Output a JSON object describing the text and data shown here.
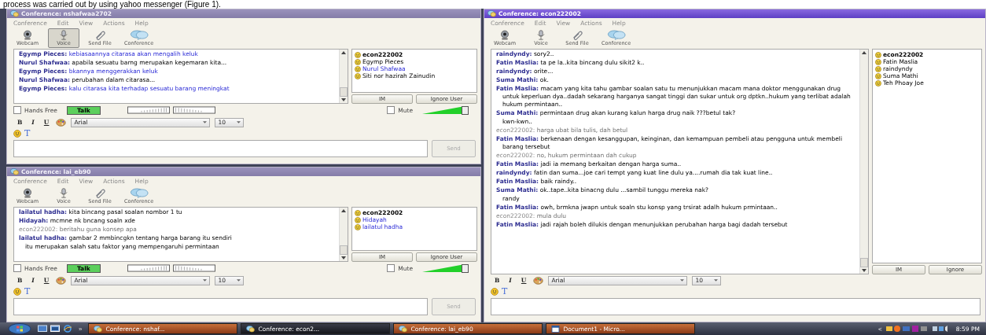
{
  "document_text": "process was carried out by using yahoo messenger (Figure 1).",
  "windows": [
    {
      "title": "Conference: nshafwaa2702",
      "active": false,
      "menu": [
        "Conference",
        "Edit",
        "View",
        "Actions",
        "Help"
      ],
      "toolbar": [
        {
          "kind": "webcam",
          "label": "Webcam",
          "selected": false
        },
        {
          "kind": "voice",
          "label": "Voice",
          "selected": true
        },
        {
          "kind": "file",
          "label": "Send File",
          "selected": false
        },
        {
          "kind": "conference",
          "label": "Conference",
          "selected": false
        }
      ],
      "messages": [
        {
          "kind": "message",
          "sender": "Egymp Pieces:",
          "text": "kebiasaannya citarasa akan mengalih keluk",
          "highlight": true
        },
        {
          "kind": "message",
          "sender": "Nurul Shafwaa:",
          "text": "apabila sesuatu barng merupakan kegemaran kita...",
          "highlight": false
        },
        {
          "kind": "message",
          "sender": "Egymp Pieces:",
          "text": "bkannya menggerakkan keluk",
          "highlight": true
        },
        {
          "kind": "message",
          "sender": "Nurul Shafwaa:",
          "text": "perubahan dalam citarasa...",
          "highlight": false
        },
        {
          "kind": "message",
          "sender": "Egymp Pieces:",
          "text": "kalu citarasa kita terhadap sesuatu barang meningkat",
          "highlight": true
        }
      ],
      "participants": [
        {
          "name": "econ222002",
          "bold": true,
          "highlight": false
        },
        {
          "name": "Egymp Pieces",
          "bold": false,
          "highlight": false
        },
        {
          "name": "Nurul Shafwaa",
          "bold": false,
          "highlight": true
        },
        {
          "name": "Siti nor hazirah Zainudin",
          "bold": false,
          "highlight": false
        }
      ],
      "im_label": "IM",
      "ignore_label": "Ignore User",
      "voice": {
        "hands_free": "Hands Free",
        "hands_free_checked": false,
        "talk": "Talk",
        "mute": "Mute",
        "mute_checked": false,
        "level": 0.9
      },
      "format": {
        "bold": "B",
        "italic": "I",
        "underline": "U",
        "font": "Arial",
        "size": "10",
        "style_glyph": "T"
      },
      "send_label": "Send"
    },
    {
      "title": "Conference: lai_eb90",
      "active": false,
      "menu": [
        "Conference",
        "Edit",
        "View",
        "Actions",
        "Help"
      ],
      "toolbar": [
        {
          "kind": "webcam",
          "label": "Webcam",
          "selected": false
        },
        {
          "kind": "voice",
          "label": "Voice",
          "selected": false
        },
        {
          "kind": "file",
          "label": "Send File",
          "selected": false
        },
        {
          "kind": "conference",
          "label": "Conference",
          "selected": false
        }
      ],
      "messages": [
        {
          "kind": "message",
          "sender": "lailatul hadha:",
          "text": "kita bincang pasal soalan nombor 1 tu",
          "highlight": false
        },
        {
          "kind": "message",
          "sender": "Hidayah:",
          "text": "mcmne nk bncang soaln xde",
          "highlight": false
        },
        {
          "kind": "self",
          "sender": "econ222002:",
          "text": "beritahu guna konsep apa",
          "highlight": false
        },
        {
          "kind": "message",
          "sender": "lailatul hadha:",
          "text": "gambar 2 mmbincgkn tentang harga barang itu sendiri",
          "highlight": false
        },
        {
          "kind": "continuation",
          "text": "itu merupakan salah satu faktor yang mempengaruhi permintaan",
          "highlight": false
        }
      ],
      "participants": [
        {
          "name": "econ222002",
          "bold": true,
          "highlight": false
        },
        {
          "name": "Hidayah",
          "bold": false,
          "highlight": true
        },
        {
          "name": "lailatul hadha",
          "bold": false,
          "highlight": true
        }
      ],
      "im_label": "IM",
      "ignore_label": "Ignore User",
      "voice": {
        "hands_free": "Hands Free",
        "hands_free_checked": false,
        "talk": "Talk",
        "mute": "Mute",
        "mute_checked": false,
        "level": 0.9
      },
      "format": {
        "bold": "B",
        "italic": "I",
        "underline": "U",
        "font": "Arial",
        "size": "10",
        "style_glyph": "T"
      },
      "send_label": "Send"
    },
    {
      "title": "Conference: econ222002",
      "active": true,
      "menu": [
        "Conference",
        "Edit",
        "View",
        "Actions",
        "Help"
      ],
      "toolbar": [
        {
          "kind": "webcam",
          "label": "Webcam",
          "selected": false
        },
        {
          "kind": "voice",
          "label": "Voice",
          "selected": false
        },
        {
          "kind": "file",
          "label": "Send File",
          "selected": false
        },
        {
          "kind": "conference",
          "label": "Conference",
          "selected": false
        }
      ],
      "messages": [
        {
          "kind": "message",
          "sender": "raindyndy:",
          "text": "sory2..",
          "highlight": false
        },
        {
          "kind": "message",
          "sender": "Fatin Maslia:",
          "text": "ta pe la..kita bincang dulu sikit2 k..",
          "highlight": false
        },
        {
          "kind": "message",
          "sender": "raindyndy:",
          "text": "orite...",
          "highlight": false
        },
        {
          "kind": "message",
          "sender": "Suma Mathi:",
          "text": "ok.",
          "highlight": false
        },
        {
          "kind": "message",
          "sender": "Fatin Maslia:",
          "text": "macam yang kita tahu gambar soalan satu tu menunjukkan macam mana doktor menggunakan drug untuk keperluan dya..dadah sekarang harganya sangat tinggi dan sukar untuk org dptkn..hukum yang terlibat adalah hukum permintaan..",
          "highlight": false
        },
        {
          "kind": "message",
          "sender": "Suma Mathi:",
          "text": "permintaan drug akan kurang kalun harga drug naik ???betul tak?",
          "highlight": false
        },
        {
          "kind": "continuation",
          "text": "kwn-kwn..",
          "highlight": false
        },
        {
          "kind": "self",
          "sender": "econ222002:",
          "text": "harga ubat bila tulis, dah betul",
          "highlight": false
        },
        {
          "kind": "message",
          "sender": "Fatin Maslia:",
          "text": "berkenaan dengan kesanggupan, keinginan, dan kemampuan pembeli atau pengguna untuk membeli barang tersebut",
          "highlight": false
        },
        {
          "kind": "self",
          "sender": "econ222002:",
          "text": "no, hukum permintaan dah cukup",
          "highlight": false
        },
        {
          "kind": "message",
          "sender": "Fatin Maslia:",
          "text": "jadi ia memang berkaitan dengan harga suma..",
          "highlight": false
        },
        {
          "kind": "message",
          "sender": "raindyndy:",
          "text": "fatin dan suma...joe cari tempt yang kuat line dulu ya....rumah dia tak kuat line..",
          "highlight": false
        },
        {
          "kind": "message",
          "sender": "Fatin Maslia:",
          "text": "baik raindy..",
          "highlight": false
        },
        {
          "kind": "message",
          "sender": "Suma Mathi:",
          "text": "ok..tape..kita binacng dulu ...sambil tunggu mereka nak?",
          "highlight": false
        },
        {
          "kind": "continuation",
          "text": "randy",
          "highlight": false
        },
        {
          "kind": "message",
          "sender": "Fatin Maslia:",
          "text": "owh, brmkna jwapn untuk soaln stu konsp yang trsirat adalh hukum prmintaan..",
          "highlight": false
        },
        {
          "kind": "self",
          "sender": "econ222002:",
          "text": "mula dulu",
          "highlight": false
        },
        {
          "kind": "message",
          "sender": "Fatin Maslia:",
          "text": "jadi rajah boleh dilukis dengan menunjukkan perubahan harga bagi dadah tersebut",
          "highlight": false
        }
      ],
      "participants": [
        {
          "name": "econ222002",
          "bold": true,
          "highlight": false
        },
        {
          "name": "Fatin Maslia",
          "bold": false,
          "highlight": false
        },
        {
          "name": "raindyndy",
          "bold": false,
          "highlight": false
        },
        {
          "name": "Suma Mathi",
          "bold": false,
          "highlight": false
        },
        {
          "name": "Teh Phoay Joe",
          "bold": false,
          "highlight": false
        }
      ],
      "im_label": "IM",
      "ignore_label": "Ignore",
      "format": {
        "bold": "B",
        "italic": "I",
        "underline": "U",
        "font": "Arial",
        "size": "10",
        "style_glyph": "T"
      }
    }
  ],
  "taskbar": {
    "more": "»",
    "tasks": [
      {
        "kind": "messenger",
        "label": "Conference: nshaf...",
        "selected": false
      },
      {
        "kind": "messenger",
        "label": "Conference: econ2...",
        "selected": true
      },
      {
        "kind": "messenger",
        "label": "Conference: lai_eb90",
        "selected": false
      },
      {
        "kind": "document",
        "label": "Document1 - Micro...",
        "selected": false
      }
    ],
    "tray_arrow": "<",
    "clock": "8:59 PM"
  }
}
